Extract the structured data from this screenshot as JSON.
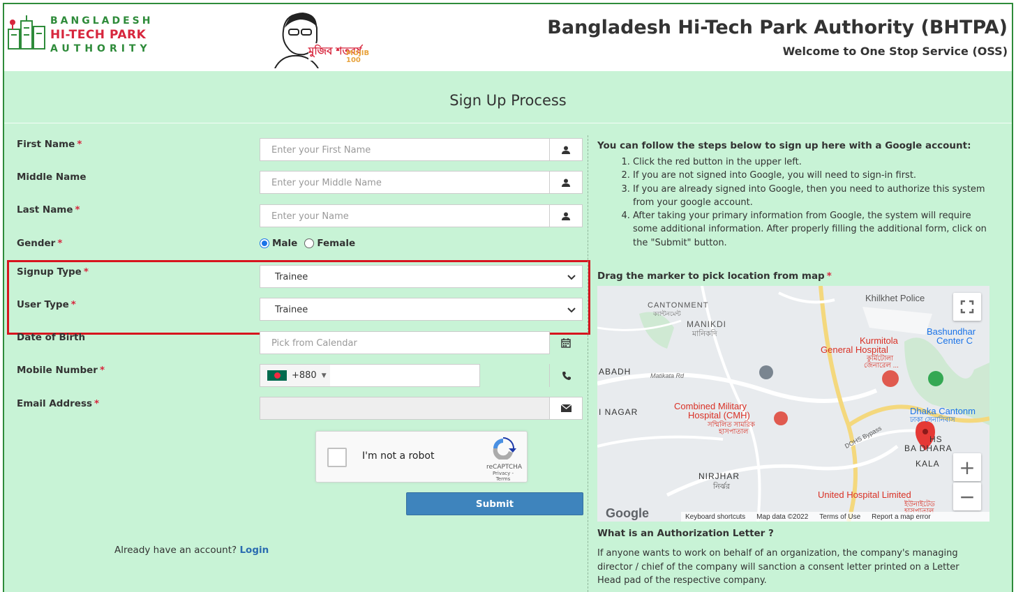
{
  "header": {
    "logo_line1": "BANGLADESH",
    "logo_line2": "HI-TECH PARK",
    "logo_line3": "AUTHORITY",
    "emblem_text": "মুজিব শতবর্ষ",
    "emblem_sub": "MUJIB 100",
    "title": "Bangladesh Hi-Tech Park Authority (BHTPA)",
    "subtitle": "Welcome to One Stop Service (OSS)"
  },
  "page_title": "Sign Up Process",
  "form": {
    "required_mark": "*",
    "first_name": {
      "label": "First Name",
      "placeholder": "Enter your First Name",
      "icon": "user-icon"
    },
    "middle_name": {
      "label": "Middle Name",
      "placeholder": "Enter your Middle Name",
      "icon": "user-icon"
    },
    "last_name": {
      "label": "Last Name",
      "placeholder": "Enter your Name",
      "icon": "user-icon"
    },
    "gender": {
      "label": "Gender",
      "options": [
        "Male",
        "Female"
      ],
      "selected": "Male"
    },
    "signup_type": {
      "label": "Signup Type",
      "value": "Trainee"
    },
    "user_type": {
      "label": "User Type",
      "value": "Trainee"
    },
    "dob": {
      "label": "Date of Birth",
      "placeholder": "Pick from Calendar",
      "icon": "calendar-icon"
    },
    "mobile": {
      "label": "Mobile Number",
      "country_code": "+880",
      "icon": "phone-icon"
    },
    "email": {
      "label": "Email Address",
      "icon": "envelope-icon"
    },
    "captcha": {
      "text": "I'm not a robot",
      "brand": "reCAPTCHA",
      "links": "Privacy - Terms"
    },
    "submit_label": "Submit",
    "already_text": "Already have an account?",
    "login_label": "Login"
  },
  "right": {
    "google_heading": "You can follow the steps below to sign up here with a Google account:",
    "steps": [
      "Click the red button in the upper left.",
      "If you are not signed into Google, you will need to sign-in first.",
      "If you are already signed into Google, then you need to authorize this system from your google account.",
      "After taking your primary information from Google, the system will require some additional information. After properly filling the additional form, click on the \"Submit\" button."
    ],
    "map_label": "Drag the marker to pick location from map",
    "auth_heading": "What is an Authorization Letter ?",
    "auth_text": "If anyone wants to work on behalf of an organization, the company's managing director / chief of the company will sanction a consent letter printed on a Letter Head pad of the respective company."
  },
  "map": {
    "places": {
      "cantonment": "CANTONMENT",
      "cantonment_bn": "ক্যান্টনমেন্ট",
      "manikdi": "MANIKDI",
      "manikdi_bn": "মানিকদি",
      "kurmitola": "Kurmitola",
      "kurmitola_hosp": "General Hospital",
      "kurmitola_bn": "কুর্মিটোলা",
      "kurmitola_bn2": "জেনারেল ...",
      "khilkhet": "Khilkhet Police",
      "bashundhara": "Bashundhar",
      "bashundhara2": "Center C",
      "abadh": "ABADH",
      "matikata": "Matikata Rd",
      "nagar": "I NAGAR",
      "cmh1": "Combined Military",
      "cmh2": "Hospital (CMH)",
      "cmh_bn1": "সম্মিলিত সামরিক",
      "cmh_bn2": "হাসপাতাল",
      "dhaka_canton": "Dhaka Cantonm",
      "dhaka_canton_bn": "ঢাকা সেনানিবাস",
      "dohs": "DOHS Bypass",
      "dhs": "HS",
      "bashundhara_r": "BA   DHARA",
      "kala": "KALA",
      "nirjhar": "NIRJHAR",
      "nirjhar_bn": "নির্ঝর",
      "united": "United Hospital Limited",
      "united_bn": "ইউনাইটেড",
      "united_bn2": "হাসপাতাল"
    },
    "google": "Google",
    "footer": [
      "Keyboard shortcuts",
      "Map data ©2022",
      "Terms of Use",
      "Report a map error"
    ],
    "zoom_in": "+",
    "zoom_out": "−"
  },
  "colors": {
    "background": "#c8f3d6",
    "border": "#2e8b3a",
    "submit": "#3e84bd",
    "required": "#d7263d",
    "highlight": "#d7141e",
    "link": "#2a6cb0"
  }
}
